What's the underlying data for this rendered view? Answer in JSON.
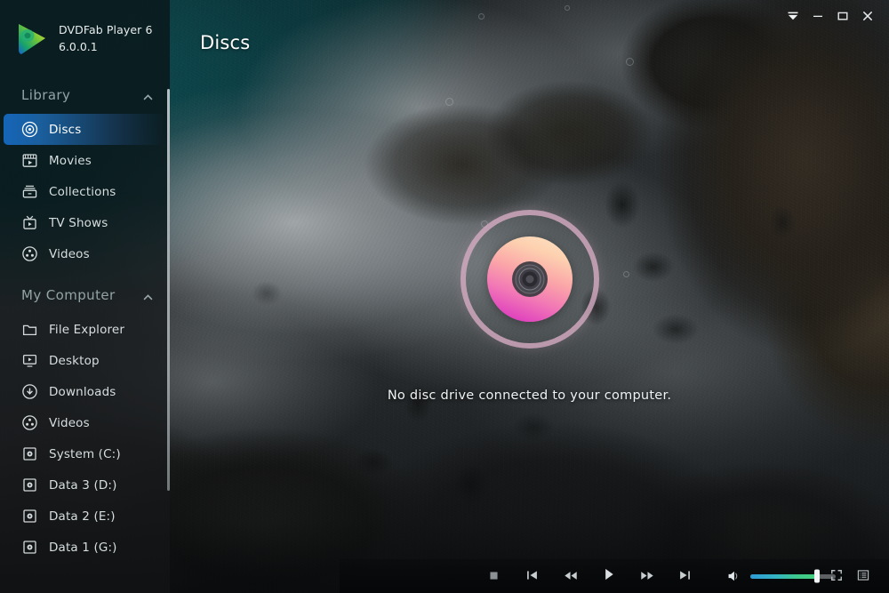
{
  "app": {
    "brand_name": "DVDFab Player 6",
    "version": "6.0.0.1",
    "logo_icon": "dvdfab-play-logo"
  },
  "window_controls": [
    {
      "name": "menu-button",
      "icon": "caret-down-menu-icon",
      "label": "Menu"
    },
    {
      "name": "minimize-button",
      "icon": "minimize-icon",
      "label": "Minimize"
    },
    {
      "name": "maximize-button",
      "icon": "maximize-icon",
      "label": "Maximize"
    },
    {
      "name": "close-button",
      "icon": "close-icon",
      "label": "Close"
    }
  ],
  "sidebar": {
    "groups": [
      {
        "title": "Library",
        "collapse_icon": "chevron-up-icon",
        "items": [
          {
            "label": "Discs",
            "icon": "disc-icon",
            "active": true
          },
          {
            "label": "Movies",
            "icon": "clapperboard-icon",
            "active": false
          },
          {
            "label": "Collections",
            "icon": "collections-icon",
            "active": false
          },
          {
            "label": "TV Shows",
            "icon": "tv-icon",
            "active": false
          },
          {
            "label": "Videos",
            "icon": "film-reel-icon",
            "active": false
          }
        ]
      },
      {
        "title": "My Computer",
        "collapse_icon": "chevron-up-icon",
        "items": [
          {
            "label": "File Explorer",
            "icon": "folder-icon",
            "active": false
          },
          {
            "label": "Desktop",
            "icon": "monitor-icon",
            "active": false
          },
          {
            "label": "Downloads",
            "icon": "download-icon",
            "active": false
          },
          {
            "label": "Videos",
            "icon": "film-reel-icon",
            "active": false
          },
          {
            "label": "System (C:)",
            "icon": "drive-icon",
            "active": false
          },
          {
            "label": "Data 3 (D:)",
            "icon": "drive-icon",
            "active": false
          },
          {
            "label": "Data 2 (E:)",
            "icon": "drive-icon",
            "active": false
          },
          {
            "label": "Data 1 (G:)",
            "icon": "drive-icon",
            "active": false
          }
        ]
      }
    ]
  },
  "main": {
    "page_title": "Discs",
    "empty_state": {
      "icon": "disc-graphic",
      "message": "No disc drive connected to your computer."
    }
  },
  "controls": {
    "transport": [
      {
        "name": "stop-button",
        "icon": "stop-icon"
      },
      {
        "name": "previous-button",
        "icon": "skip-previous-icon"
      },
      {
        "name": "rewind-button",
        "icon": "rewind-icon"
      },
      {
        "name": "play-button",
        "icon": "play-icon"
      },
      {
        "name": "fast-forward-button",
        "icon": "fast-forward-icon"
      },
      {
        "name": "next-button",
        "icon": "skip-next-icon"
      }
    ],
    "volume": {
      "icon": "speaker-icon",
      "level_percent": 78
    },
    "right": [
      {
        "name": "fullscreen-button",
        "icon": "fullscreen-icon"
      },
      {
        "name": "playlist-button",
        "icon": "playlist-icon"
      }
    ]
  },
  "colors": {
    "accent_active": "#1565b8",
    "disc_gradient_start": "#fde3c6",
    "disc_gradient_end": "#d935bb",
    "disc_ring": "#d8acc4",
    "volume_fill_start": "#2f9ad6",
    "volume_fill_end": "#46d07f",
    "sidebar_text": "#d7dedf",
    "group_title": "#93a3a6"
  }
}
